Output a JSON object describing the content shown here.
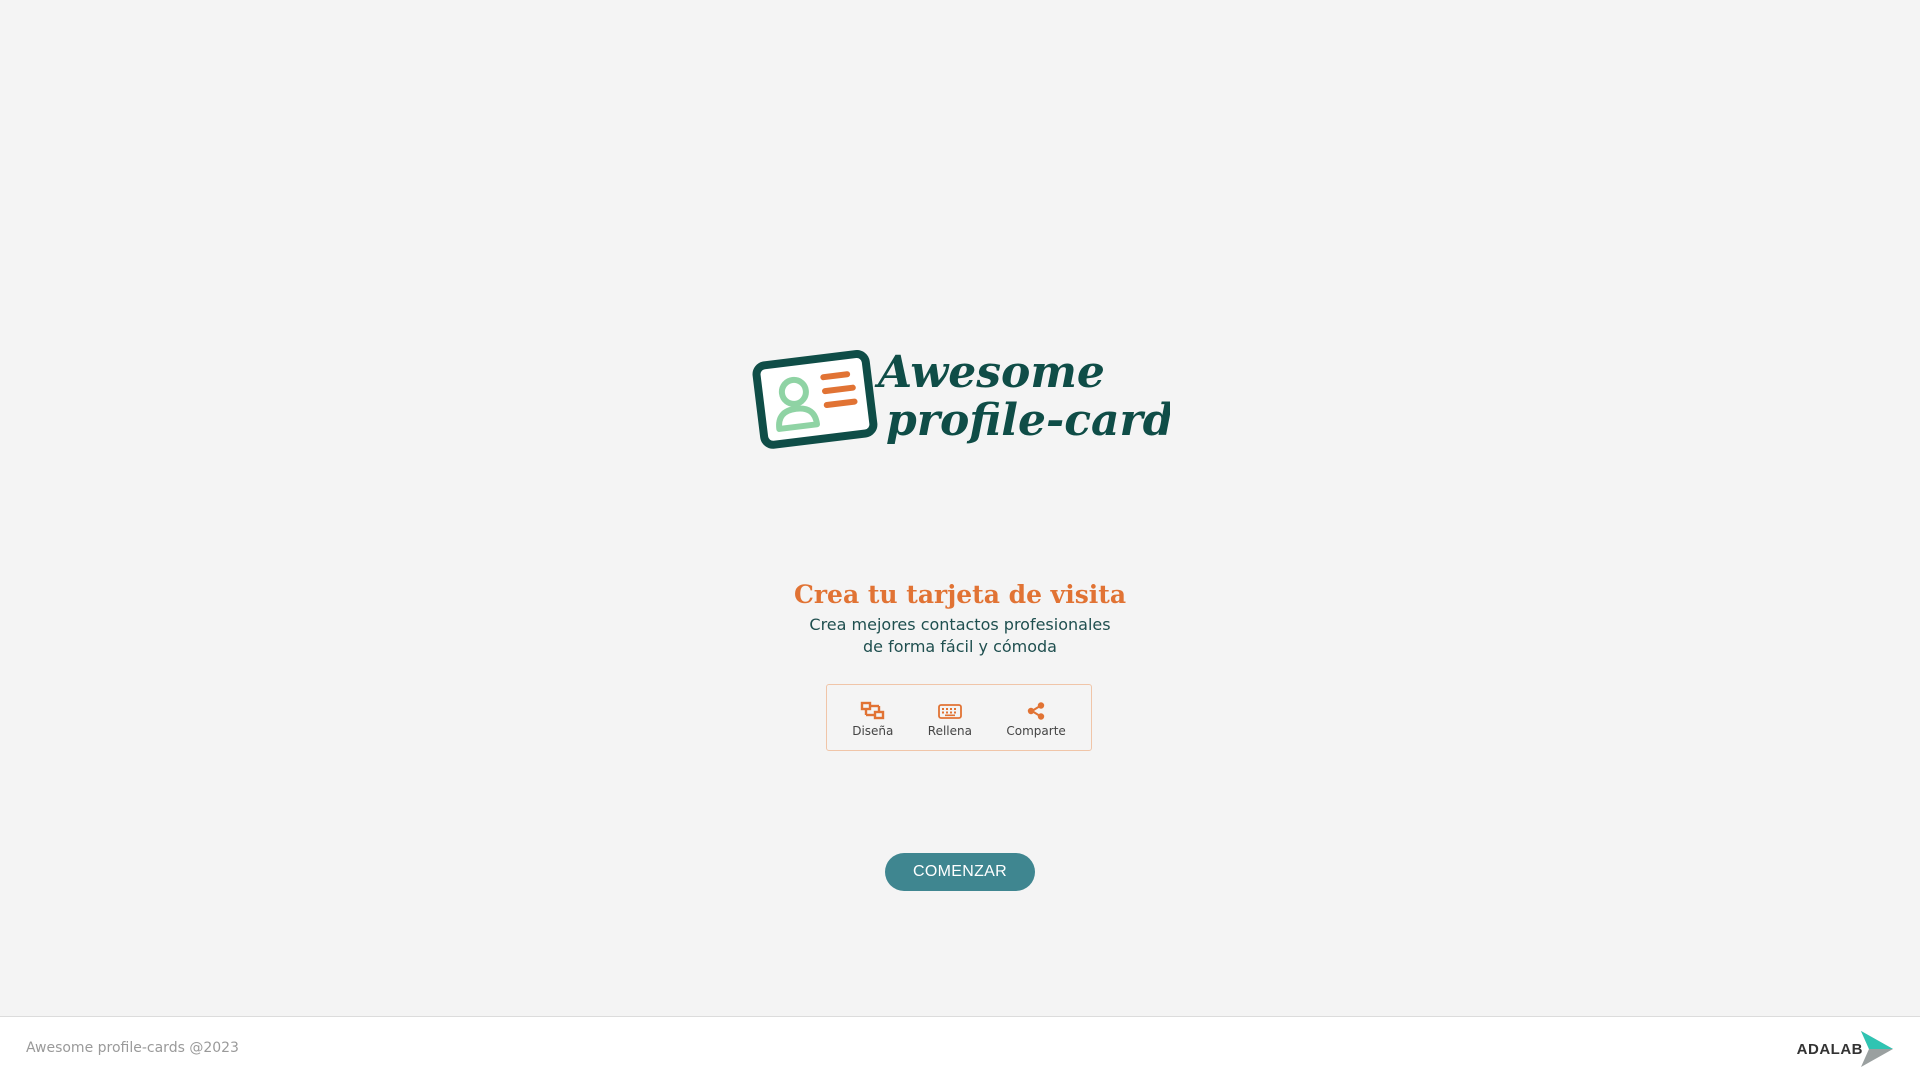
{
  "brand": {
    "logo_line1": "Awesome",
    "logo_line2": "profile-cards",
    "logo_icon": "id-card-icon"
  },
  "hero": {
    "title": "Crea tu tarjeta de visita",
    "subtitle": "Crea mejores contactos profesionales de forma fácil y cómoda"
  },
  "steps": [
    {
      "label": "Diseña",
      "icon": "design-crop-icon"
    },
    {
      "label": "Rellena",
      "icon": "keyboard-icon"
    },
    {
      "label": "Comparte",
      "icon": "share-icon"
    }
  ],
  "cta": {
    "label": "COMENZAR"
  },
  "footer": {
    "copyright": "Awesome profile-cards @2023",
    "partner_logo": "ADALAB"
  },
  "colors": {
    "accent_orange": "#e17334",
    "brand_dark_green": "#0f4d47",
    "brand_light_green": "#8fd3a4",
    "button_teal": "#3f8690",
    "background": "#f4f4f4",
    "adalab_teal": "#2fc4b2"
  }
}
